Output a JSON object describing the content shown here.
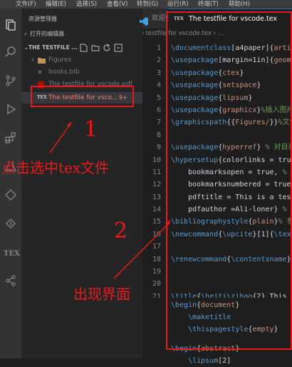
{
  "menubar": {
    "items": [
      "文件(F)",
      "编辑(E)",
      "选择(S)",
      "查看(V)",
      "转到(G)",
      "运行(R)",
      "终端(T)",
      "帮助(H)"
    ]
  },
  "sidebar": {
    "title": "资源管理器",
    "open_editors": "打开的编辑器",
    "folder": "THE TESTFILE ...",
    "items": [
      {
        "label": "Figures",
        "icon": "folder-icon"
      },
      {
        "label": "books.bib",
        "icon": "bib-file-icon"
      },
      {
        "label": "The testfile for vscode.pdf",
        "icon": "pdf-file-icon"
      },
      {
        "label": "The testfile for vsco...",
        "icon": "tex-file-icon",
        "badge": "9+"
      }
    ]
  },
  "editor": {
    "tabs": [
      {
        "label": "欢迎使用",
        "icon": "vscode-icon"
      },
      {
        "label": "The testfile for vscode.tex",
        "icon": "tex-file-icon"
      }
    ],
    "breadcrumb": "The testfile for vscode.tex › ..."
  },
  "annotations": {
    "num1": "1",
    "text1": "点击选中tex文件",
    "num2": "2",
    "text2": "出现界面"
  },
  "colors": {
    "annotation_red": "#e8191a",
    "accent_blue": "#007acc",
    "tex_red": "#f48771"
  }
}
